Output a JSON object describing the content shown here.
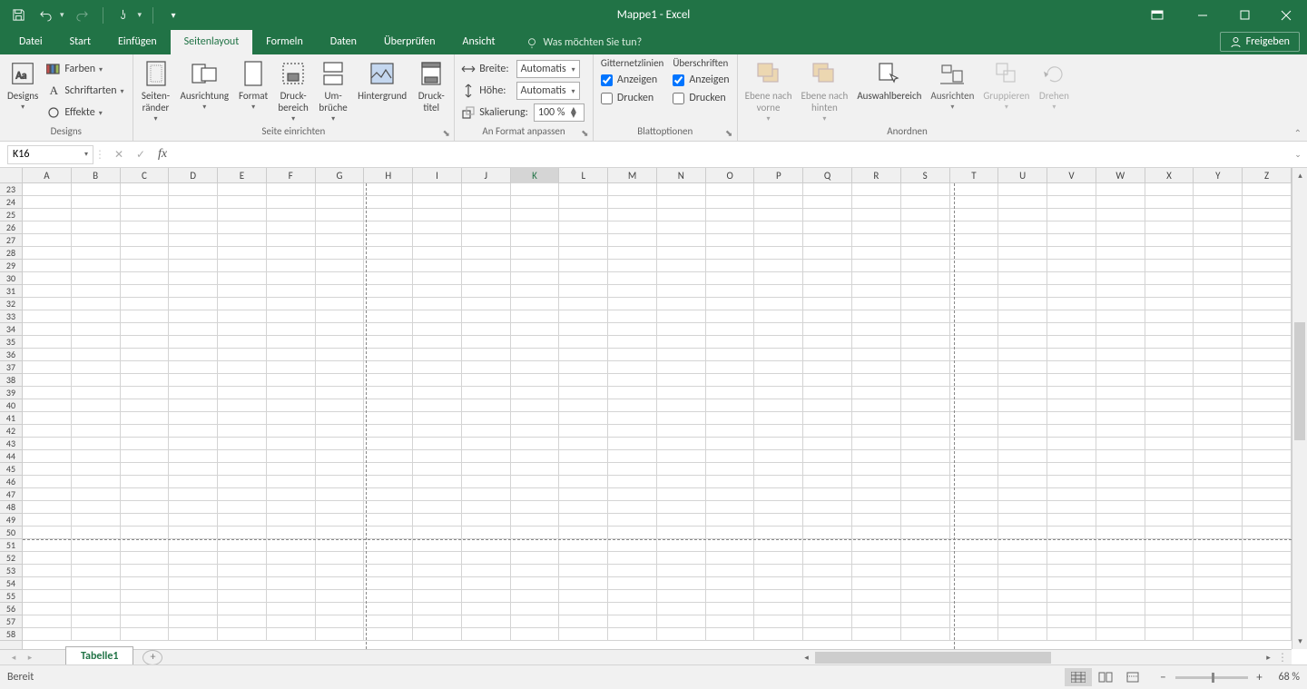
{
  "title": "Mappe1 - Excel",
  "qat": [
    "save-icon",
    "undo-icon",
    "redo-icon",
    "touch-icon"
  ],
  "tabs": {
    "file": "Datei",
    "start": "Start",
    "einfuegen": "Einfügen",
    "seitenlayout": "Seitenlayout",
    "formeln": "Formeln",
    "daten": "Daten",
    "ueberpruefen": "Überprüfen",
    "ansicht": "Ansicht",
    "active": "seitenlayout"
  },
  "tellme": "Was möchten Sie tun?",
  "share": "Freigeben",
  "ribbon": {
    "designs": {
      "label": "Designs",
      "btnDesigns": "Designs",
      "farben": "Farben",
      "schriftarten": "Schriftarten",
      "effekte": "Effekte"
    },
    "seiteEinrichten": {
      "label": "Seite einrichten",
      "seitenraender": "Seiten-\nränder",
      "ausrichtung": "Ausrichtung",
      "format": "Format",
      "druckbereich": "Druck-\nbereich",
      "umbrueche": "Um-\nbrüche",
      "hintergrund": "Hintergrund",
      "drucktitel": "Druck-\ntitel"
    },
    "anFormat": {
      "label": "An Format anpassen",
      "breite": "Breite:",
      "hoehe": "Höhe:",
      "skalierung": "Skalierung:",
      "auto": "Automatis",
      "scale": "100 %"
    },
    "blattoptionen": {
      "label": "Blattoptionen",
      "gitter": "Gitternetzlinien",
      "ueber": "Überschriften",
      "anzeigen": "Anzeigen",
      "drucken": "Drucken",
      "gitterAnzeigen": true,
      "gitterDrucken": false,
      "ueberAnzeigen": true,
      "ueberDrucken": false
    },
    "anordnen": {
      "label": "Anordnen",
      "ebeneVorne": "Ebene nach\nvorne",
      "ebeneHinten": "Ebene nach\nhinten",
      "auswahl": "Auswahlbereich",
      "ausrichten": "Ausrichten",
      "gruppieren": "Gruppieren",
      "drehen": "Drehen"
    }
  },
  "namebox": "K16",
  "columns": [
    "A",
    "B",
    "C",
    "D",
    "E",
    "F",
    "G",
    "H",
    "I",
    "J",
    "K",
    "L",
    "M",
    "N",
    "O",
    "P",
    "Q",
    "R",
    "S",
    "T",
    "U",
    "V",
    "W",
    "X",
    "Y",
    "Z"
  ],
  "activeCol": "K",
  "rowStart": 23,
  "rowEnd": 58,
  "pageBreakCols": [
    "H",
    "T"
  ],
  "hPageBreakRow": 50,
  "sheetTab": "Tabelle1",
  "status": "Bereit",
  "zoom": "68 %"
}
